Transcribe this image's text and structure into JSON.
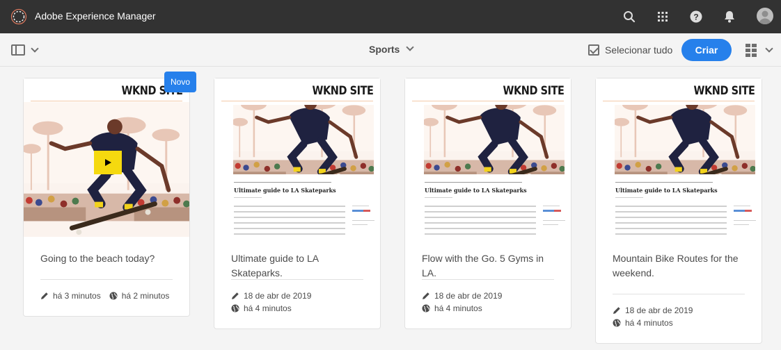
{
  "shell": {
    "app_title": "Adobe Experience Manager",
    "icons": [
      "search-icon",
      "apps-icon",
      "help-icon",
      "notifications-icon",
      "user-avatar"
    ]
  },
  "actionbar": {
    "title": "Sports",
    "select_all_label": "Selecionar tudo",
    "create_label": "Criar"
  },
  "colors": {
    "accent": "#2680eb",
    "shell_bg": "#323232",
    "play_button": "#f5d90f"
  },
  "cards": [
    {
      "title": "Going to the beach today?",
      "badge": "Novo",
      "kind": "video",
      "modified": "há 3 minutos",
      "published": "há 2 minutos"
    },
    {
      "title": "Ultimate guide to LA Skateparks.",
      "kind": "page",
      "site_label": "WKND SITE",
      "page_heading": "Ultimate guide to LA Skateparks",
      "modified": "18 de abr de 2019",
      "published": "há 4 minutos"
    },
    {
      "title": "Flow with the Go. 5 Gyms in LA.",
      "kind": "page",
      "site_label": "WKND SITE",
      "page_heading": "Ultimate guide to LA Skateparks",
      "modified": "18 de abr de 2019",
      "published": "há 4 minutos"
    },
    {
      "title": "Mountain Bike Routes for the weekend.",
      "kind": "page",
      "site_label": "WKND SITE",
      "page_heading": "Ultimate guide to LA Skateparks",
      "modified": "18 de abr de 2019",
      "published": "há 4 minutos"
    }
  ],
  "first_card_site_label": "WKND SITE"
}
